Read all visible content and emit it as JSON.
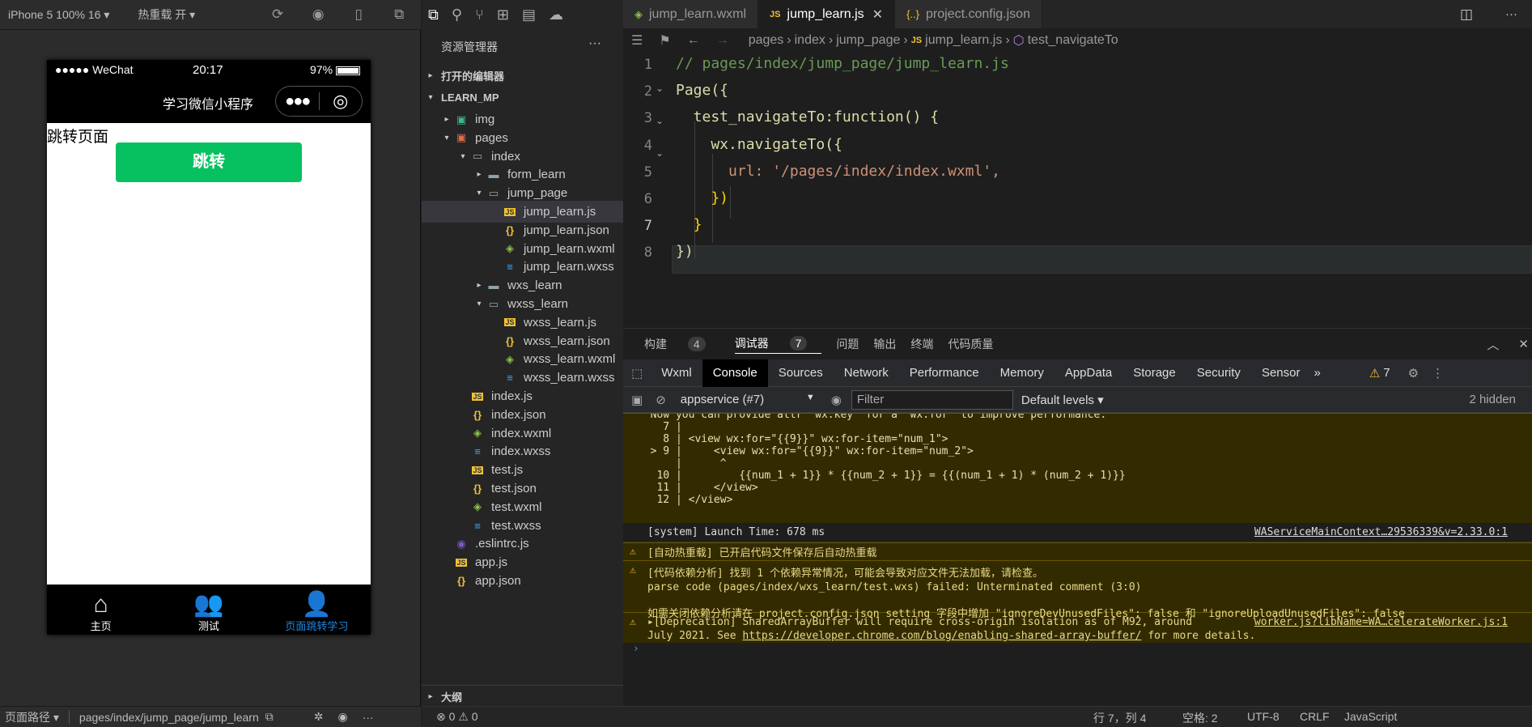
{
  "simulator": {
    "device": "iPhone 5 100% 16",
    "hotreload": "热重载 开",
    "status": {
      "signal": "●●●●● WeChat",
      "time": "20:17",
      "battery": "97%"
    },
    "nav_title": "学习微信小程序",
    "page_text": "跳转页面",
    "jump_button": "跳转",
    "tabs": [
      {
        "label": "主页"
      },
      {
        "label": "测试"
      },
      {
        "label": "页面跳转学习"
      }
    ],
    "path_label": "页面路径",
    "path_value": "pages/index/jump_page/jump_learn"
  },
  "explorer": {
    "title": "资源管理器",
    "open_editors": "打开的编辑器",
    "project": "LEARN_MP",
    "outline": "大纲",
    "tree": [
      {
        "label": "img",
        "arrow": "▸",
        "icon": "▣",
        "color": "#3fb68b"
      },
      {
        "label": "pages",
        "arrow": "▾",
        "icon": "▣",
        "color": "#e06c4b"
      },
      {
        "label": "index",
        "arrow": "▾",
        "icon": "▭",
        "color": "#90a4ae"
      },
      {
        "label": "form_learn",
        "arrow": "▸",
        "icon": "▬",
        "color": "#90a4ae"
      },
      {
        "label": "jump_page",
        "arrow": "▾",
        "icon": "▭",
        "color": "#90a4ae"
      },
      {
        "label": "jump_learn.js",
        "arrow": "",
        "icon": "JS",
        "color": "#f1c232"
      },
      {
        "label": "jump_learn.json",
        "arrow": "",
        "icon": "{}",
        "color": "#f1c232"
      },
      {
        "label": "jump_learn.wxml",
        "arrow": "",
        "icon": "◈",
        "color": "#8bc34a"
      },
      {
        "label": "jump_learn.wxss",
        "arrow": "",
        "icon": "≡",
        "color": "#42a5f5"
      },
      {
        "label": "wxs_learn",
        "arrow": "▸",
        "icon": "▬",
        "color": "#90a4ae"
      },
      {
        "label": "wxss_learn",
        "arrow": "▾",
        "icon": "▭",
        "color": "#90a4ae"
      },
      {
        "label": "wxss_learn.js",
        "arrow": "",
        "icon": "JS",
        "color": "#f1c232"
      },
      {
        "label": "wxss_learn.json",
        "arrow": "",
        "icon": "{}",
        "color": "#f1c232"
      },
      {
        "label": "wxss_learn.wxml",
        "arrow": "",
        "icon": "◈",
        "color": "#8bc34a"
      },
      {
        "label": "wxss_learn.wxss",
        "arrow": "",
        "icon": "≡",
        "color": "#42a5f5"
      },
      {
        "label": "index.js",
        "arrow": "",
        "icon": "JS",
        "color": "#f1c232"
      },
      {
        "label": "index.json",
        "arrow": "",
        "icon": "{}",
        "color": "#f1c232"
      },
      {
        "label": "index.wxml",
        "arrow": "",
        "icon": "◈",
        "color": "#8bc34a"
      },
      {
        "label": "index.wxss",
        "arrow": "",
        "icon": "≡",
        "color": "#42a5f5"
      },
      {
        "label": "test.js",
        "arrow": "",
        "icon": "JS",
        "color": "#f1c232"
      },
      {
        "label": "test.json",
        "arrow": "",
        "icon": "{}",
        "color": "#f1c232"
      },
      {
        "label": "test.wxml",
        "arrow": "",
        "icon": "◈",
        "color": "#8bc34a"
      },
      {
        "label": "test.wxss",
        "arrow": "",
        "icon": "≡",
        "color": "#42a5f5"
      },
      {
        "label": ".eslintrc.js",
        "arrow": "",
        "icon": "◉",
        "color": "#7e57c2"
      },
      {
        "label": "app.js",
        "arrow": "",
        "icon": "JS",
        "color": "#f1c232"
      },
      {
        "label": "app.json",
        "arrow": "",
        "icon": "{}",
        "color": "#f1c232"
      }
    ]
  },
  "editor": {
    "tabs": [
      {
        "label": "jump_learn.wxml",
        "icon": "◈"
      },
      {
        "label": "jump_learn.js",
        "icon": "JS"
      },
      {
        "label": "project.config.json",
        "icon": "{}"
      }
    ],
    "breadcrumb": [
      "pages",
      "index",
      "jump_page",
      "jump_learn.js",
      "test_navigateTo"
    ],
    "lines": [
      {
        "n": "1",
        "code": "// pages/index/jump_page/jump_learn.js"
      },
      {
        "n": "2",
        "code": "Page({"
      },
      {
        "n": "3",
        "code": "  test_navigateTo:function() {"
      },
      {
        "n": "4",
        "code": "    wx.navigateTo({"
      },
      {
        "n": "5",
        "code": "      url: '/pages/index/index.wxml',"
      },
      {
        "n": "6",
        "code": "    })"
      },
      {
        "n": "7",
        "code": "  }"
      },
      {
        "n": "8",
        "code": "})"
      }
    ]
  },
  "panel": {
    "tabs": [
      "构建",
      "4",
      "调试器",
      "7",
      "问题",
      "输出",
      "终端",
      "代码质量"
    ],
    "devtools_tabs": [
      "Wxml",
      "Console",
      "Sources",
      "Network",
      "Performance",
      "Memory",
      "AppData",
      "Storage",
      "Security",
      "Sensor"
    ],
    "warn_count": "7",
    "context": "appservice (#7)",
    "filter_placeholder": "Filter",
    "levels": "Default levels",
    "hidden": "2 hidden",
    "console_top": [
      "  Now you can provide attr \"wx:key\" for a \"wx:for\" to improve performance.",
      "    7 |",
      "    8 | <view wx:for=\"{{9}}\" wx:for-item=\"num_1\">",
      "  > 9 |     <view wx:for=\"{{9}}\" wx:for-item=\"num_2\">",
      "      |      ^",
      "   10 |         {{num_1 + 1}} * {{num_2 + 1}} = {{(num_1 + 1) * (num_2 + 1)}}",
      "   11 |     </view>",
      "   12 | </view>"
    ],
    "system_line": "[system] Launch Time: 678 ms",
    "system_link": "WAServiceMainContext…29536339&v=2.33.0:1",
    "warn1": "[自动热重载] 已开启代码文件保存后自动热重载",
    "warn2_a": "[代码依赖分析] 找到 1 个依赖异常情况，可能会导致对应文件无法加载，请检查。",
    "warn2_b": "parse code (pages/index/wxs_learn/test.wxs) failed: Unterminated comment (3:0)",
    "warn2_c": "如需关闭依赖分析请在 project.config.json setting 字段中增加 \"ignoreDevUnusedFiles\": false 和 \"ignoreUploadUnusedFiles\": false",
    "warn3_a": "▸[Deprecation] SharedArrayBuffer will require cross-origin isolation as of M92, around",
    "warn3_link": "worker.js?libName=WA…celerateWorker.js:1",
    "warn3_b": "July 2021. See",
    "warn3_url": "https://developer.chrome.com/blog/enabling-shared-array-buffer/",
    "warn3_c": "for more details."
  },
  "status": {
    "errors": "⊗ 0 ⚠ 0",
    "position": "行 7，列 4",
    "spaces": "空格: 2",
    "encoding": "UTF-8",
    "eol": "CRLF",
    "lang": "JavaScript"
  }
}
